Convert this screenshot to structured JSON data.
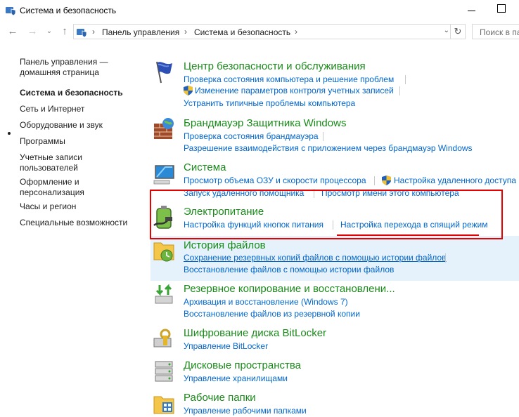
{
  "window": {
    "title": "Система и безопасность"
  },
  "address": {
    "crumbs": [
      "Панель управления",
      "Система и безопасность"
    ],
    "search_placeholder": "Поиск в пан"
  },
  "leftnav": {
    "items": [
      "Панель управления —",
      "домашняя страница",
      "Система и безопасность",
      "Сеть и Интернет",
      "Оборудование и звук",
      "Программы",
      "Учетные записи",
      "пользователей",
      "Оформление и",
      "персонализация",
      "Часы и регион",
      "Специальные возможности"
    ]
  },
  "categories": {
    "security_center": {
      "title": "Центр безопасности и обслуживания",
      "links": [
        "Проверка состояния компьютера и решение проблем",
        "Изменение параметров контроля учетных записей",
        "Устранить типичные проблемы компьютера"
      ]
    },
    "firewall": {
      "title": "Брандмауэр Защитника Windows",
      "links": [
        "Проверка состояния брандмауэра",
        "Разрешение взаимодействия с приложением через брандмауэр Windows"
      ]
    },
    "system": {
      "title": "Система",
      "links": [
        "Просмотр объема ОЗУ и скорости процессора",
        "Настройка удаленного доступа",
        "Запуск удаленного помощника",
        "Просмотр имени этого компьютера"
      ]
    },
    "power": {
      "title": "Электропитание",
      "links": [
        "Настройка функций кнопок питания",
        "Настройка перехода в спящий режим"
      ]
    },
    "file_history": {
      "title": "История файлов",
      "links": [
        "Сохранение резервных копий файлов с помощью истории файлов",
        "Восстановление файлов с помощью истории файлов"
      ]
    },
    "backup": {
      "title": "Резервное копирование и восстановлени...",
      "links": [
        "Архивация и восстановление (Windows 7)",
        "Восстановление файлов из резервной копии"
      ]
    },
    "bitlocker": {
      "title": "Шифрование диска BitLocker",
      "links": [
        "Управление BitLocker"
      ]
    },
    "storage": {
      "title": "Дисковые пространства",
      "links": [
        "Управление хранилищами"
      ]
    },
    "work_folders": {
      "title": "Рабочие папки",
      "links": [
        "Управление рабочими папками"
      ]
    }
  },
  "colors": {
    "category_title": "#1a8a1a",
    "link": "#0066cc",
    "annotation": "#e60000",
    "hover_row": "#e5f1fb"
  }
}
